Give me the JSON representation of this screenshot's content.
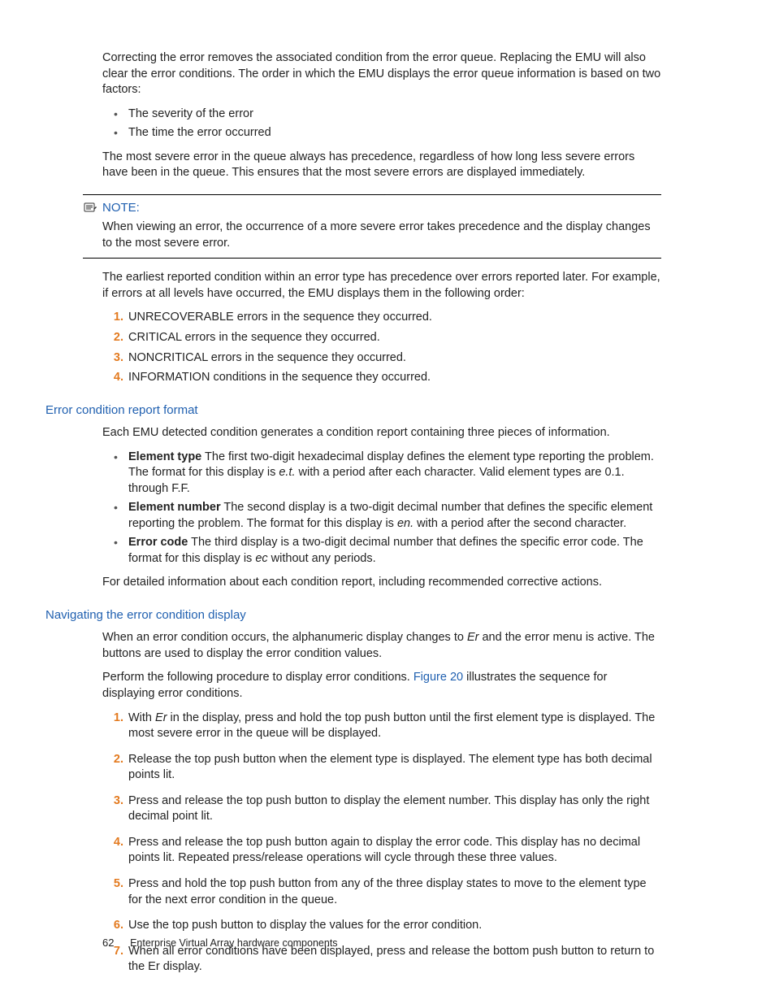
{
  "intro_p1": "Correcting the error removes the associated condition from the error queue. Replacing the EMU will also clear the error conditions. The order in which the EMU displays the error queue information is based on two factors:",
  "factors": [
    "The severity of the error",
    "The time the error occurred"
  ],
  "intro_p2": "The most severe error in the queue always has precedence, regardless of how long less severe errors have been in the queue. This ensures that the most severe errors are displayed immediately.",
  "note": {
    "label": "NOTE:",
    "body": "When viewing an error, the occurrence of a more severe error takes precedence and the display changes to the most severe error."
  },
  "precedence_p": "The earliest reported condition within an error type has precedence over errors reported later. For example, if errors at all levels have occurred, the EMU displays them in the following order:",
  "precedence_list": [
    "UNRECOVERABLE errors in the sequence they occurred.",
    "CRITICAL errors in the sequence they occurred.",
    "NONCRITICAL errors in the sequence they occurred.",
    "INFORMATION conditions in the sequence they occurred."
  ],
  "sec1": {
    "heading": "Error condition report format",
    "intro": "Each EMU detected condition generates a condition report containing three pieces of information.",
    "items": [
      {
        "bold": "Element type",
        "rest_a": " The first two-digit hexadecimal display defines the element type reporting the problem. The format for this display is ",
        "ital": "e.t.",
        "rest_b": " with a period after each character. Valid element types are 0.1. through F.F."
      },
      {
        "bold": "Element number",
        "rest_a": " The second display is a two-digit decimal number that defines the specific element reporting the problem. The format for this display is ",
        "ital": "en.",
        "rest_b": " with a period after the second character."
      },
      {
        "bold": "Error code",
        "rest_a": " The third display is a two-digit decimal number that defines the specific error code. The format for this display is ",
        "ital": "ec",
        "rest_b": " without any periods."
      }
    ],
    "outro": "For detailed information about each condition report, including recommended corrective actions."
  },
  "sec2": {
    "heading": "Navigating the error condition display",
    "p1_a": "When an error condition occurs, the alphanumeric display changes to ",
    "p1_ital": "Er",
    "p1_b": " and the error menu is active. The buttons are used to display the error condition values.",
    "p2_a": "Perform the following procedure to display error conditions. ",
    "p2_link": "Figure 20",
    "p2_b": " illustrates the sequence for displaying error conditions.",
    "steps": [
      {
        "a": "With ",
        "ital": "Er",
        "b": " in the display, press and hold the top push button until the first element type is displayed. The most severe error in the queue will be displayed."
      },
      {
        "a": "Release the top push button when the element type is displayed. The element type has both decimal points lit."
      },
      {
        "a": "Press and release the top push button to display the element number. This display has only the right decimal point lit."
      },
      {
        "a": "Press and release the top push button again to display the error code. This display has no decimal points lit. Repeated press/release operations will cycle through these three values."
      },
      {
        "a": "Press and hold the top push button from any of the three display states to move to the element type for the next error condition in the queue."
      },
      {
        "a": "Use the top push button to display the values for the error condition."
      },
      {
        "a": "When all error conditions have been displayed, press and release the bottom push button to return to the Er display."
      }
    ]
  },
  "footer": {
    "page": "62",
    "title": "Enterprise Virtual Array hardware components"
  }
}
